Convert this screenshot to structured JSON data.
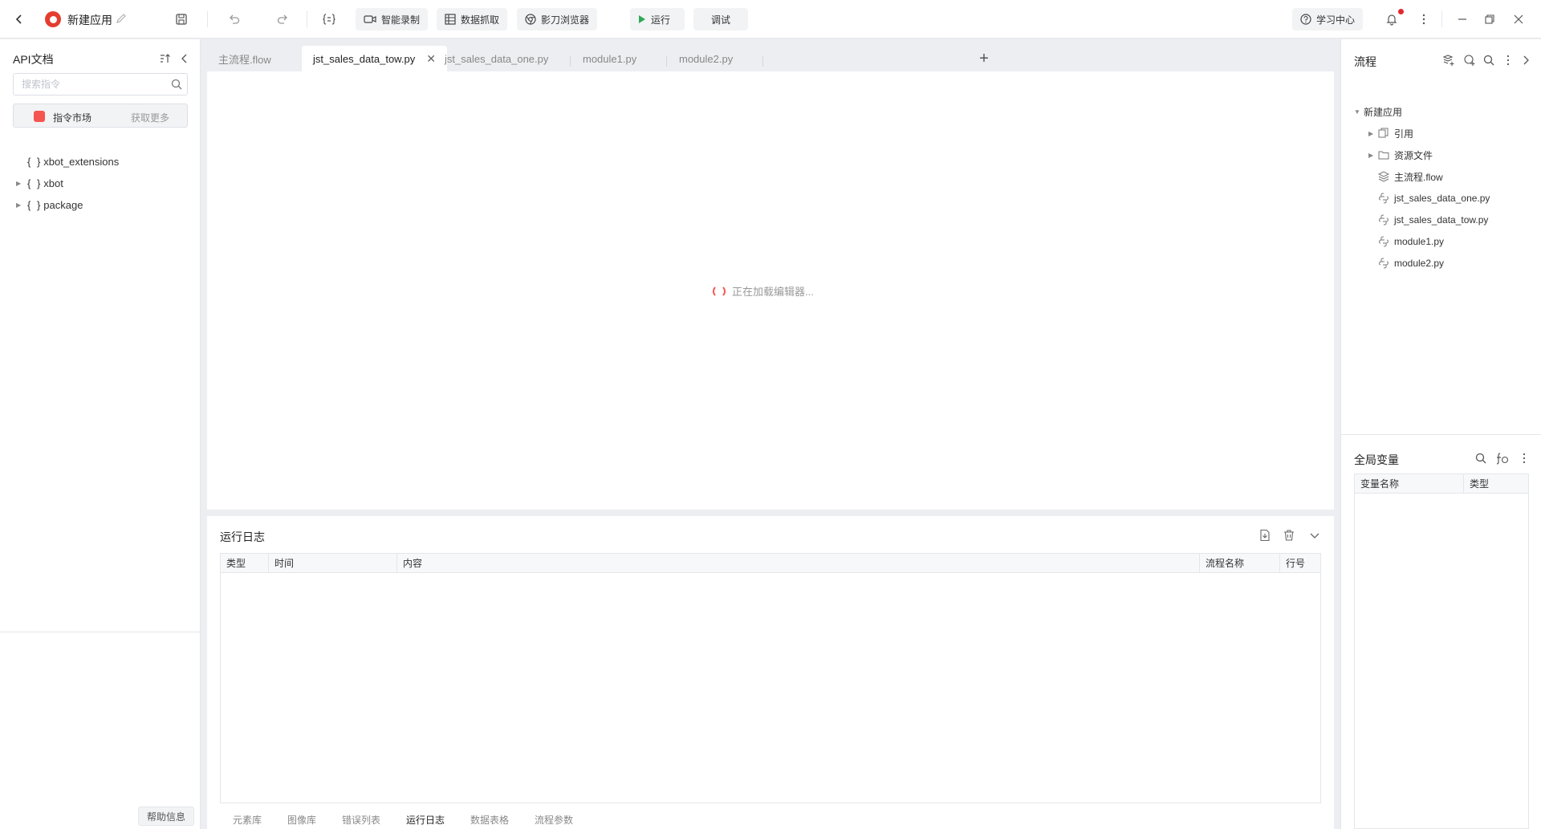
{
  "app": {
    "title": "新建应用"
  },
  "toolbar": {
    "smart_record": "智能录制",
    "data_capture": "数据抓取",
    "browser": "影刀浏览器",
    "run": "运行",
    "debug": "调试",
    "learning_center": "学习中心"
  },
  "left_panel": {
    "title": "API文档",
    "search_placeholder": "搜索指令",
    "market_label": "指令市场",
    "market_more": "获取更多",
    "tree": [
      {
        "label": "xbot_extensions",
        "expandable": false
      },
      {
        "label": "xbot",
        "expandable": true
      },
      {
        "label": "package",
        "expandable": true
      }
    ],
    "help": "帮助信息"
  },
  "tabs": [
    {
      "label": "主流程.flow",
      "active": false
    },
    {
      "label": "jst_sales_data_tow.py",
      "active": true
    },
    {
      "label": "jst_sales_data_one.py",
      "active": false
    },
    {
      "label": "module1.py",
      "active": false
    },
    {
      "label": "module2.py",
      "active": false
    }
  ],
  "editor": {
    "loading_text": "正在加载编辑器..."
  },
  "log": {
    "title": "运行日志",
    "columns": [
      "类型",
      "时间",
      "内容",
      "流程名称",
      "行号"
    ],
    "bottom_tabs": [
      "元素库",
      "图像库",
      "错误列表",
      "运行日志",
      "数据表格",
      "流程参数"
    ],
    "active_tab": "运行日志"
  },
  "right_panel": {
    "title": "流程",
    "tree": [
      {
        "label": "新建应用",
        "level": 0,
        "expanded": true,
        "icon": "none"
      },
      {
        "label": "引用",
        "level": 1,
        "expandable": true,
        "icon": "reference-icon"
      },
      {
        "label": "资源文件",
        "level": 1,
        "expandable": true,
        "icon": "folder-icon"
      },
      {
        "label": "主流程.flow",
        "level": 1,
        "expandable": false,
        "icon": "layers-icon"
      },
      {
        "label": "jst_sales_data_one.py",
        "level": 1,
        "expandable": false,
        "icon": "python-icon"
      },
      {
        "label": "jst_sales_data_tow.py",
        "level": 1,
        "expandable": false,
        "icon": "python-icon"
      },
      {
        "label": "module1.py",
        "level": 1,
        "expandable": false,
        "icon": "python-icon"
      },
      {
        "label": "module2.py",
        "level": 1,
        "expandable": false,
        "icon": "python-icon"
      }
    ],
    "vars_title": "全局变量",
    "var_columns": [
      "变量名称",
      "类型"
    ]
  },
  "colors": {
    "brand": "#e43d2f",
    "run_green": "#2eaa55",
    "notification": "#e5262e"
  }
}
